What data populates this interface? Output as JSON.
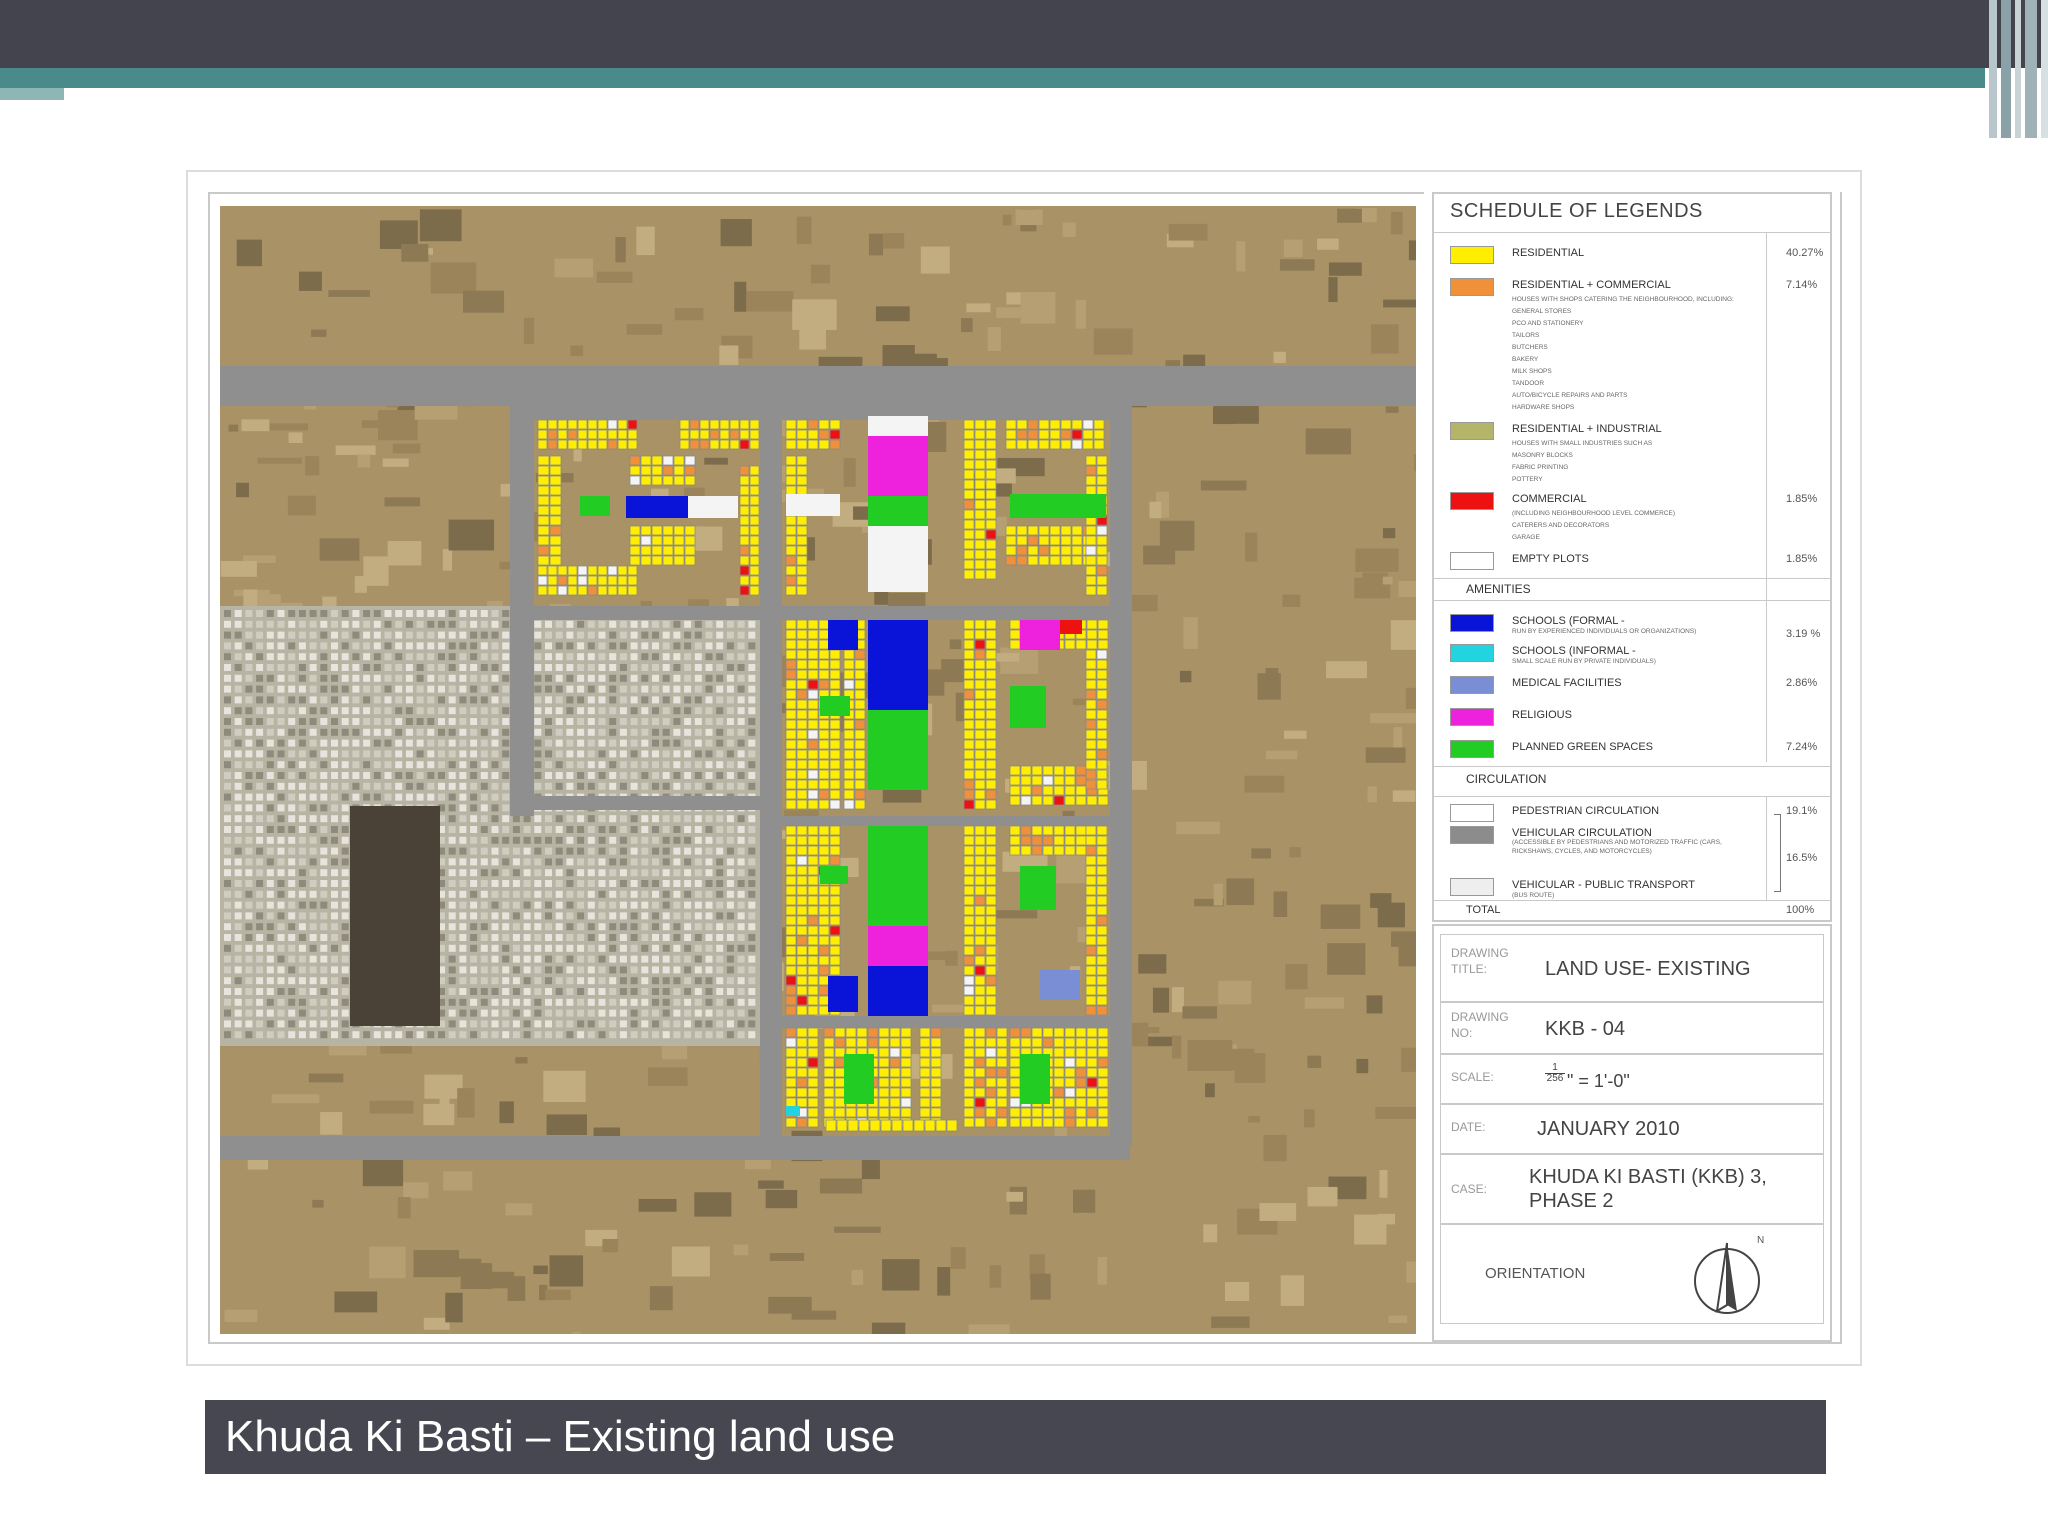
{
  "slide": {
    "caption": "Khuda Ki Basti – Existing land use"
  },
  "legend": {
    "title": "SCHEDULE OF LEGENDS",
    "land_use": [
      {
        "label": "RESIDENTIAL",
        "color": "#ffee00",
        "pct": "40.27%",
        "details": []
      },
      {
        "label": "RESIDENTIAL + COMMERCIAL",
        "color": "#f0913a",
        "pct": "7.14%",
        "details": [
          "HOUSES WITH SHOPS CATERING THE NEIGHBOURHOOD, INCLUDING:",
          "GENERAL STORES",
          "PCO AND STATIONERY",
          "TAILORS",
          "BUTCHERS",
          "BAKERY",
          "MILK SHOPS",
          "TANDOOR",
          "AUTO/BICYCLE REPAIRS AND PARTS",
          "HARDWARE SHOPS"
        ]
      },
      {
        "label": "RESIDENTIAL + INDUSTRIAL",
        "color": "#b5b56a",
        "pct": "",
        "details": [
          "HOUSES WITH SMALL INDUSTRIES SUCH AS",
          "MASONRY BLOCKS",
          "FABRIC PRINTING",
          "POTTERY"
        ]
      },
      {
        "label": "COMMERCIAL",
        "color": "#ee1111",
        "pct": "1.85%",
        "details": [
          "(INCLUDING NEIGHBOURHOOD LEVEL COMMERCE)",
          "CATERERS AND DECORATORS",
          "GARAGE"
        ]
      },
      {
        "label": "EMPTY PLOTS",
        "color": "#ffffff",
        "pct": "1.85%",
        "details": []
      }
    ],
    "amenities_heading": "AMENITIES",
    "amenities": [
      {
        "label": "SCHOOLS (FORMAL -",
        "sub": "RUN BY EXPERIENCED INDIVIDUALS OR ORGANIZATIONS)",
        "color": "#0a14d8",
        "pct": "3.19 %"
      },
      {
        "label": "SCHOOLS (INFORMAL -",
        "sub": "SMALL SCALE RUN BY PRIVATE INDIVIDUALS)",
        "color": "#22d4e0",
        "pct": ""
      },
      {
        "label": "MEDICAL FACILITIES",
        "sub": "",
        "color": "#7a8ed6",
        "pct": "2.86%"
      },
      {
        "label": "RELIGIOUS",
        "sub": "",
        "color": "#ee22dd",
        "pct": ""
      },
      {
        "label": "PLANNED GREEN SPACES",
        "sub": "",
        "color": "#22cc22",
        "pct": "7.24%"
      }
    ],
    "circulation_heading": "CIRCULATION",
    "circulation": [
      {
        "label": "PEDESTRIAN CIRCULATION",
        "sub": "",
        "color": "#ffffff",
        "pct": "19.1%"
      },
      {
        "label": "VEHICULAR CIRCULATION",
        "sub": "(ACCESSIBLE BY PEDESTRIANS AND MOTORIZED TRAFFIC (CARS, RICKSHAWS, CYCLES, AND MOTORCYCLES)",
        "color": "#8c8c8c",
        "pct": "16.5%"
      },
      {
        "label": "VEHICULAR - PUBLIC TRANSPORT",
        "sub": "(BUS ROUTE)",
        "color": "#eeeeee",
        "pct": ""
      }
    ],
    "total_label": "TOTAL",
    "total_pct": "100%"
  },
  "title_block": {
    "drawing_title_label": "DRAWING TITLE:",
    "drawing_title": "LAND USE- EXISTING",
    "drawing_no_label": "DRAWING NO:",
    "drawing_no": "KKB - 04",
    "scale_label": "SCALE:",
    "scale_num": "1",
    "scale_den": "256",
    "scale_rest": "\" = 1'-0\"",
    "date_label": "DATE:",
    "date": "JANUARY 2010",
    "case_label": "CASE:",
    "case_line1": "KHUDA KI BASTI (KKB) 3,",
    "case_line2": "PHASE 2",
    "orientation_label": "ORIENTATION",
    "north_label": "N"
  },
  "map": {
    "residential": "#ffee00",
    "commercial_mix": "#f0913a",
    "commercial": "#ee1111",
    "school": "#0a14d8",
    "school_informal": "#22d4e0",
    "medical": "#7a8ed6",
    "religious": "#ee22dd",
    "green": "#22cc22",
    "road": "#8f8f8f",
    "empty": "#f4f4f4",
    "ground": "#a89266"
  }
}
